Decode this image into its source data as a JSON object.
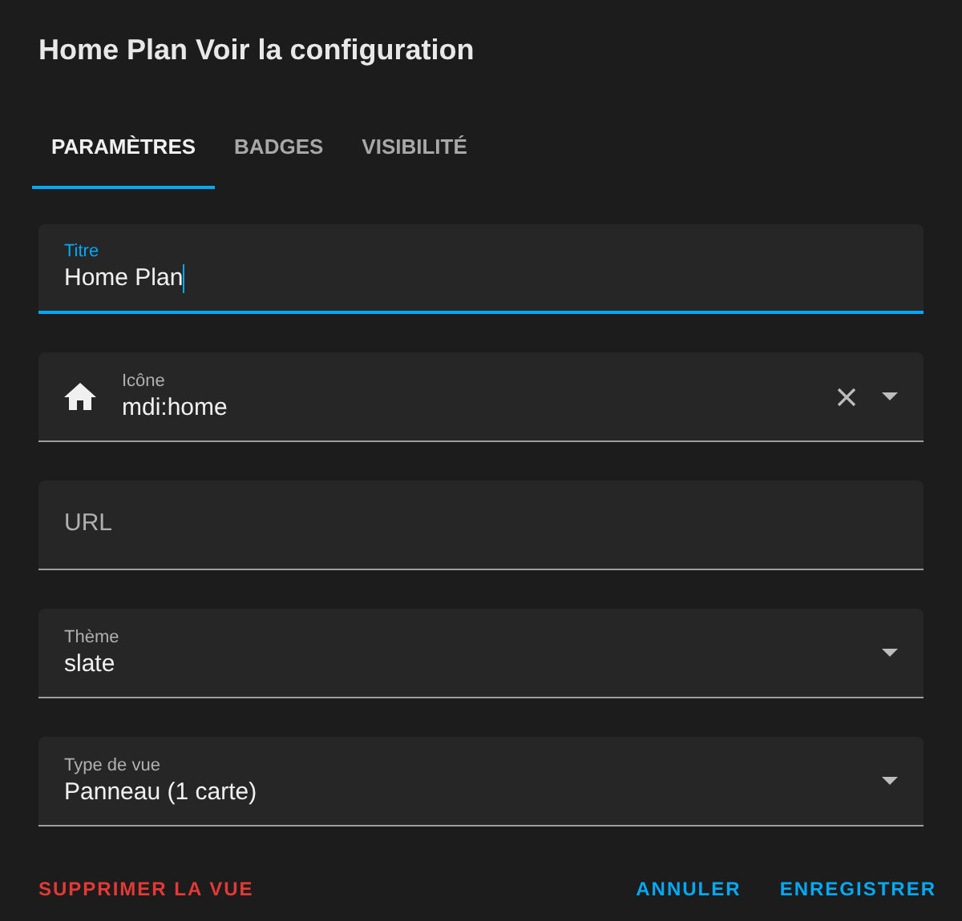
{
  "dialog": {
    "title": "Home Plan Voir la configuration"
  },
  "tabs": [
    {
      "label": "PARAMÈTRES",
      "selected": true
    },
    {
      "label": "BADGES",
      "selected": false
    },
    {
      "label": "VISIBILITÉ",
      "selected": false
    }
  ],
  "fields": [
    {
      "kind": "text",
      "label": "Titre",
      "value": "Home Plan",
      "focused": true
    },
    {
      "kind": "icon-picker",
      "label": "Icône",
      "value": "mdi:home",
      "focused": false
    },
    {
      "kind": "text",
      "label": "URL",
      "focused": false
    },
    {
      "kind": "select",
      "label": "Thème",
      "value": "slate",
      "focused": false
    },
    {
      "kind": "select",
      "label": "Type de vue",
      "value": "Panneau (1 carte)",
      "focused": false
    }
  ],
  "actions": {
    "delete": "SUPPRIMER LA VUE",
    "cancel": "ANNULER",
    "save": "ENREGISTRER"
  }
}
